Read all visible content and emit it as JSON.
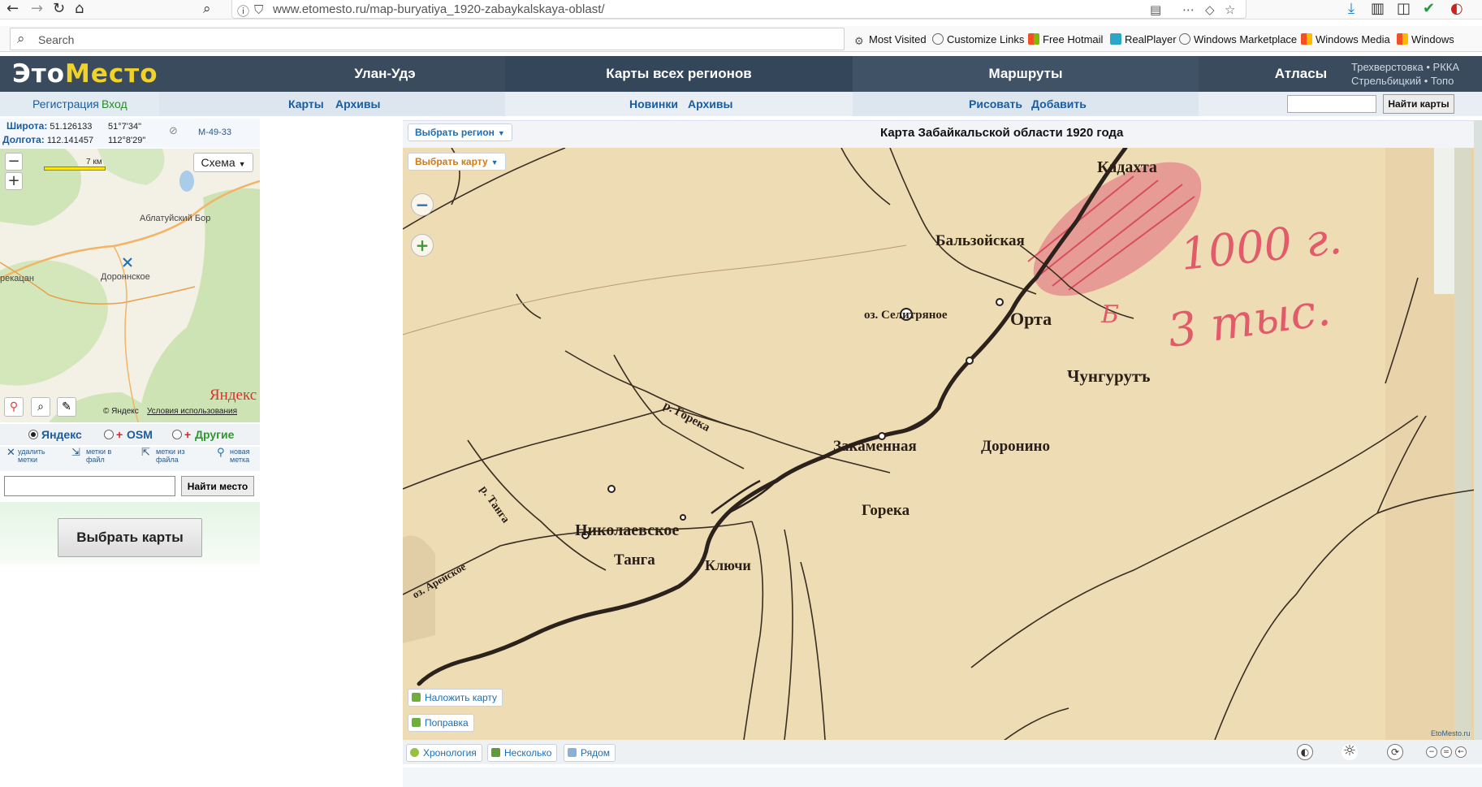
{
  "browser": {
    "url": "www.etomesto.ru/map-buryatiya_1920-zabaykalskaya-oblast/",
    "search_placeholder": "Search",
    "bookmarks": [
      "Most Visited",
      "Customize Links",
      "Free Hotmail",
      "RealPlayer",
      "Windows Marketplace",
      "Windows Media",
      "Windows"
    ]
  },
  "site": {
    "logo": {
      "part1": "Это",
      "part2": "Место"
    },
    "nav": [
      "Улан-Удэ",
      "Карты всех регионов",
      "Маршруты",
      "Атласы"
    ],
    "nav_extra": {
      "line1": "Трехверстовка • РККА",
      "line2": "Стрельбицкий • Топо"
    },
    "subnav": {
      "register": "Регистрация",
      "login": "Вход",
      "maps": "Карты",
      "archives1": "Архивы",
      "news": "Новинки",
      "archives2": "Архивы",
      "draw": "Рисовать",
      "add": "Добавить"
    },
    "find_maps_button": "Найти карты"
  },
  "left_panel": {
    "lat_label": "Широта:",
    "lat_value": "51.126133",
    "lat_dms": "51°7'34\"",
    "lon_label": "Долгота:",
    "lon_value": "112.141457",
    "lon_dms": "112°8'29\"",
    "sheet": "M-49-33",
    "scale_label": "7 км",
    "map_type": "Схема",
    "places": [
      "Аблатуйский Бор",
      "Дороннское",
      "рекацан"
    ],
    "yandex_logo": "Яндекс",
    "copyright": "© Яндекс",
    "terms": "Условия использования",
    "layers": [
      "Яндекс",
      "OSM",
      "Другие"
    ],
    "layer_selected": "Яндекс",
    "mark_actions": [
      {
        "line1": "удалить",
        "line2": "метки"
      },
      {
        "line1": "метки в",
        "line2": "файл"
      },
      {
        "line1": "метки из",
        "line2": "файла"
      },
      {
        "line1": "новая",
        "line2": "метка"
      }
    ],
    "find_place_button": "Найти место",
    "choose_maps_button": "Выбрать карты"
  },
  "map_panel": {
    "title": "Карта Забайкальской области 1920 года",
    "select_region": "Выбрать регион",
    "select_map": "Выбрать карту",
    "overlay_button": "Наложить карту",
    "correction_button": "Поправка",
    "footer_buttons": [
      "Хронология",
      "Несколько",
      "Рядом"
    ],
    "credit": "EtoMesto.ru",
    "map_labels": {
      "kadakhta": "Кадахта",
      "balzoy": "Бальзойская",
      "selitra": "оз. Селитряное",
      "orta": "Орта",
      "chunguruy": "Чунгурутъ",
      "zakamennaya": "Закаменная",
      "doronino": "Доронино",
      "goreka": "Горека",
      "goreka_river": "р. Горека",
      "nikolaevskoe": "Николаевское",
      "tanga": "Танга",
      "klyuchi": "Ключи",
      "tanga_river": "р. Танга",
      "arey": "оз. Арейское",
      "red_note1": "1000 г.",
      "red_note2": "3 тыс.",
      "red_note3": "Б"
    }
  }
}
